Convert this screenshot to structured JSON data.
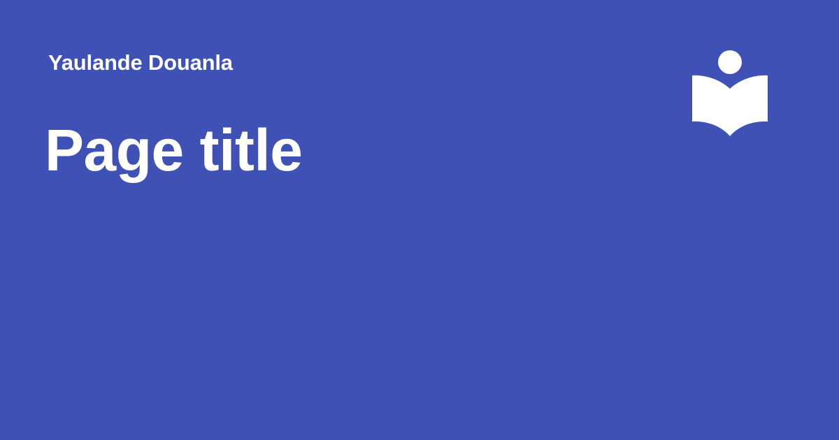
{
  "background_color": "#3f51b5",
  "text_color": "#ffffff",
  "site": {
    "name": "Yaulande Douanla"
  },
  "page": {
    "title": "Page title"
  },
  "logo": {
    "icon": "reading-book-icon"
  }
}
